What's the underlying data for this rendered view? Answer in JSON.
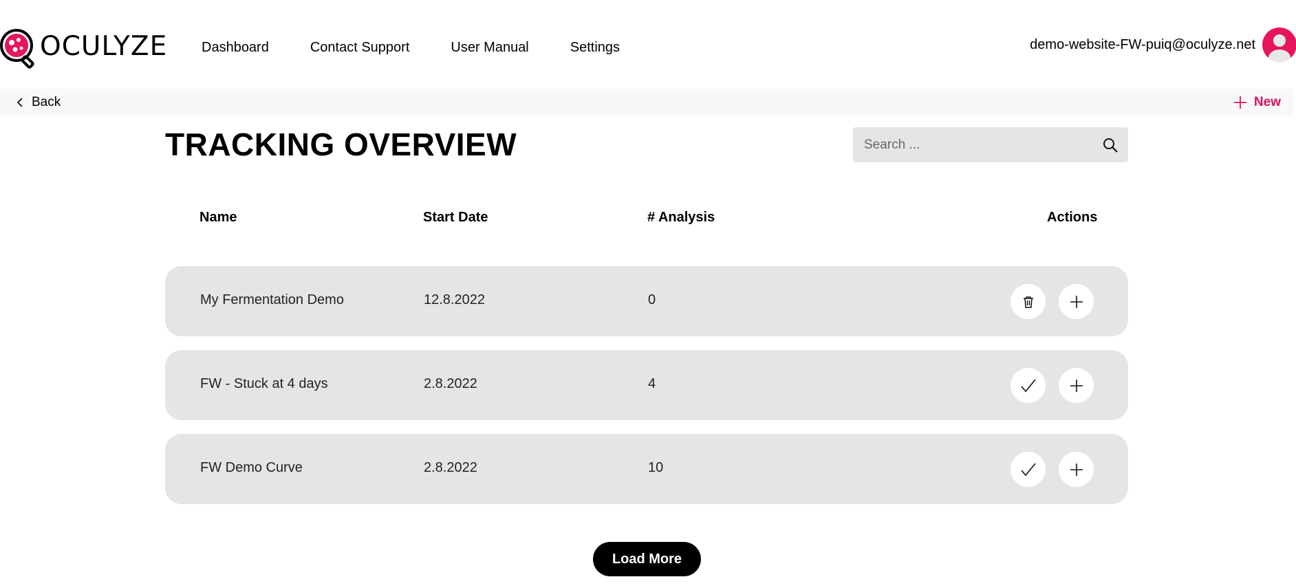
{
  "app": {
    "logo_text": "OCULYZE",
    "brand_color": "#e7155a"
  },
  "nav": {
    "items": [
      {
        "label": "Dashboard"
      },
      {
        "label": "Contact Support"
      },
      {
        "label": "User Manual"
      },
      {
        "label": "Settings"
      }
    ]
  },
  "user": {
    "email": "demo-website-FW-puiq@oculyze.net",
    "avatar_icon": "user-avatar-icon"
  },
  "subbar": {
    "back_label": "Back",
    "new_label": "New"
  },
  "page": {
    "title": "TRACKING OVERVIEW"
  },
  "search": {
    "placeholder": "Search ...",
    "value": ""
  },
  "table": {
    "headers": {
      "name": "Name",
      "start_date": "Start Date",
      "analysis": "# Analysis",
      "actions": "Actions"
    },
    "rows": [
      {
        "name": "My Fermentation Demo",
        "start_date": "12.8.2022",
        "analysis": "0",
        "primary_action": "trash-icon"
      },
      {
        "name": "FW - Stuck at 4 days",
        "start_date": "2.8.2022",
        "analysis": "4",
        "primary_action": "check-icon"
      },
      {
        "name": "FW Demo Curve",
        "start_date": "2.8.2022",
        "analysis": "10",
        "primary_action": "check-icon"
      }
    ]
  },
  "footer": {
    "load_more_label": "Load More"
  }
}
